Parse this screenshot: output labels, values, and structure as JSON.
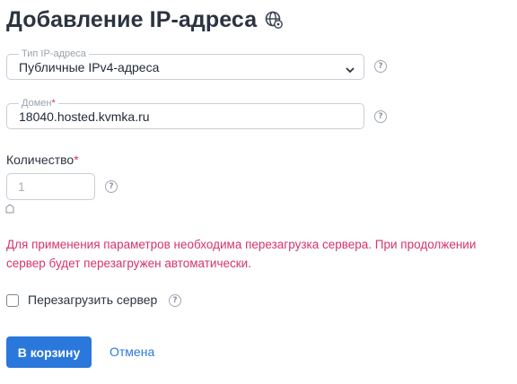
{
  "page": {
    "title": "Добавление IP-адреса",
    "title_icon": "globe-gear-icon"
  },
  "ip_type": {
    "label": "Тип IP-адреса",
    "value": "Публичные IPv4-адреса",
    "help": "?"
  },
  "domain": {
    "label": "Домен",
    "required_mark": "*",
    "value": "18040.hosted.kvmka.ru",
    "help": "?"
  },
  "quantity": {
    "label": "Количество",
    "required_mark": "*",
    "placeholder": "1",
    "help": "?"
  },
  "warning": {
    "text": "Для применения параметров необходима перезагрузка сервера. При продолжении сервер будет перезагружен автоматически."
  },
  "reboot": {
    "label": "Перезагрузить сервер",
    "checked": false,
    "help": "?"
  },
  "actions": {
    "submit_label": "В корзину",
    "cancel_label": "Отмена"
  },
  "colors": {
    "accent": "#2a78dc",
    "warning": "#d6336c",
    "border": "#c9cfd6"
  }
}
